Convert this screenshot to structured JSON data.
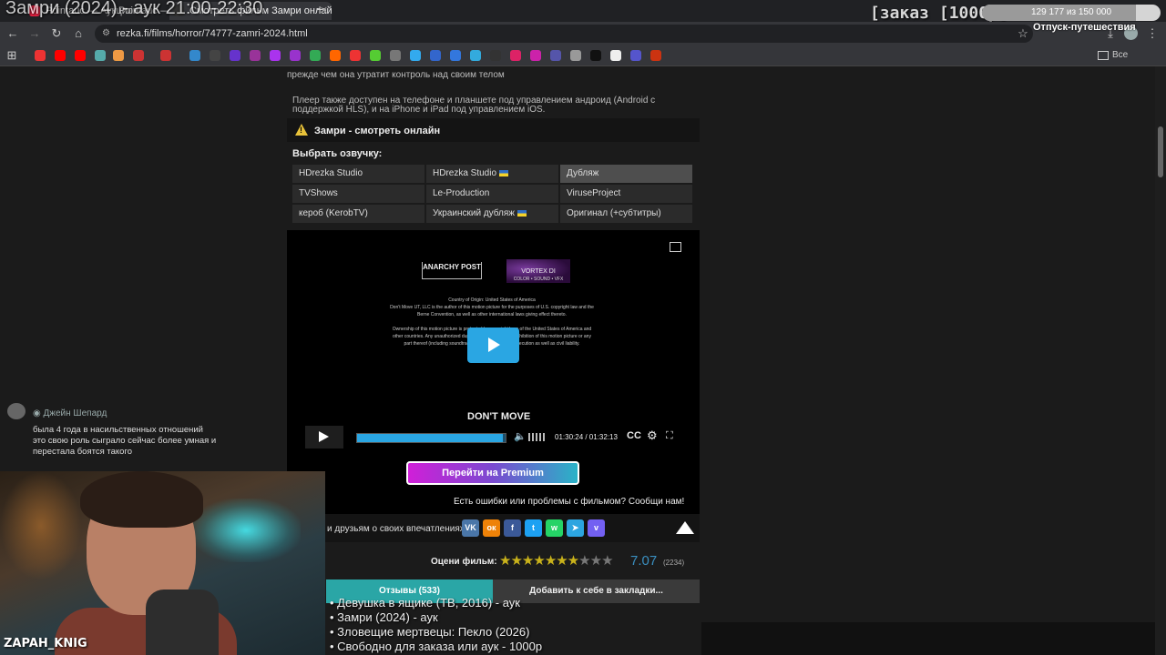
{
  "overlay": {
    "stream_title": "Замри (2024) - аук 21:00-22:30",
    "order_label": "[заказ [1000р]",
    "progress_text": "129 177 из 150 000",
    "progress_fraction": 0.861,
    "trip_label": "Отпуск-путешествия"
  },
  "browser": {
    "tabs": [
      {
        "label": "Pointauc — Аукцион"
      },
      {
        "label": "Pointauc — Аукцион (лотерея)"
      },
      {
        "label": "Смотреть фильм Замри онлайн"
      }
    ],
    "new_tab_icon": "+",
    "url": "rezka.fi/films/horror/74777-zamri-2024.html",
    "all_bookmarks": "Все закладки"
  },
  "page": {
    "intro_tail": "прежде чем она утратит контроль над своим телом",
    "player_note": "Плеер также доступен на телефоне и планшете под управлением андроид (Android с поддержкой HLS), и на iPhone и iPad под управлением iOS.",
    "warn_title": "Замри - смотреть онлайн",
    "dub_label": "Выбрать озвучку:",
    "dubs": [
      {
        "label": "HDrezka Studio",
        "ua": false,
        "selected": false
      },
      {
        "label": "HDrezka Studio",
        "ua": true,
        "selected": false
      },
      {
        "label": "Дубляж",
        "ua": false,
        "selected": true
      },
      {
        "label": "TVShows",
        "ua": false,
        "selected": false
      },
      {
        "label": "Le-Production",
        "ua": false,
        "selected": false
      },
      {
        "label": "ViruseProject",
        "ua": false,
        "selected": false
      },
      {
        "label": "кероб (KerobTV)",
        "ua": false,
        "selected": false
      },
      {
        "label": "Украинский дубляж",
        "ua": true,
        "selected": false
      },
      {
        "label": "Оригинал (+субтитры)",
        "ua": false,
        "selected": false
      }
    ],
    "player": {
      "logo1": "ANARCHY POST",
      "logo2_line1": "VORTEX DI",
      "logo2_line2": "COLOR • SOUND • VFX",
      "credits": [
        "Country of Origin: United States of America",
        "Don't Move UT, LLC is the author of this motion picture for the purposes of U.S. copyright law and the",
        "Berne Convention, as well as other international laws giving effect thereto.",
        "",
        "Ownership of this motion picture is protected by copyright laws of the United States of America and",
        "other countries. Any unauthorized duplication, distribution or exhibition of this motion picture or any",
        "part thereof (including soundtrack) may result in civil prosecution as well as civil liability."
      ],
      "movie_title_card": "DON'T MOVE",
      "time": "01:30:24 / 01:32:13",
      "progress_fraction": 0.98,
      "cc_label": "CC"
    },
    "premium_label": "Перейти на Premium",
    "errors_text": "Есть ошибки или проблемы с фильмом? Сообщи нам!",
    "share_label": "и друзьям о своих впечатлениях:",
    "social": [
      {
        "name": "vk-icon",
        "glyph": "VK",
        "color": "#4a76a8"
      },
      {
        "name": "ok-icon",
        "glyph": "ок",
        "color": "#ee8208"
      },
      {
        "name": "facebook-icon",
        "glyph": "f",
        "color": "#3b5998"
      },
      {
        "name": "twitter-icon",
        "glyph": "t",
        "color": "#1da1f2"
      },
      {
        "name": "whatsapp-icon",
        "glyph": "w",
        "color": "#25d366"
      },
      {
        "name": "telegram-icon",
        "glyph": "➤",
        "color": "#2ca5e0"
      },
      {
        "name": "viber-icon",
        "glyph": "v",
        "color": "#7360f2"
      }
    ],
    "rate_label": "Оцени фильм:",
    "stars_filled": 7,
    "stars_total": 10,
    "rating": "7.07",
    "votes": "(2234)",
    "reviews_tab": "Отзывы (533)",
    "bookmark_tab": "Добавить к себе в закладки..."
  },
  "chat": {
    "user": "Джейн Шепард",
    "lines": [
      "была 4 года в насильственных отношений",
      "это свою роль сыграло сейчас более умная и",
      "перестала  боятся такого"
    ]
  },
  "streamer_name": "ZAPAH_KNIG",
  "queue": [
    "• Девушка в ящике (ТВ, 2016) - аук",
    "• Замри (2024) - аук",
    "• Зловещие мертвецы: Пекло (2026)",
    "• Свободно для заказа или аук - 1000р"
  ]
}
